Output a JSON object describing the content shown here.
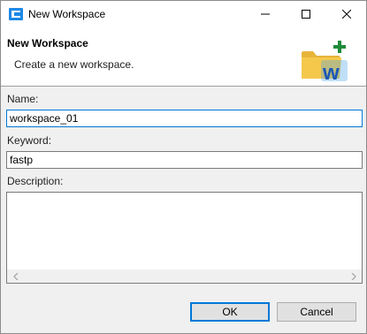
{
  "window": {
    "title": "New Workspace"
  },
  "banner": {
    "title": "New Workspace",
    "description": "Create a new workspace."
  },
  "form": {
    "name_label": "Name:",
    "name_value": "workspace_01",
    "keyword_label": "Keyword:",
    "keyword_value": "fastp",
    "description_label": "Description:",
    "description_value": ""
  },
  "buttons": {
    "ok_label": "OK",
    "cancel_label": "Cancel"
  },
  "icons": {
    "app": "app-icon",
    "banner": "new-workspace-folder-icon",
    "minimize": "minimize-icon",
    "maximize": "maximize-icon",
    "close": "close-icon"
  },
  "colors": {
    "focus_accent": "#0078d7",
    "folder": "#f5c84c",
    "plus": "#1e8a3a",
    "w_letter": "#1a56b5"
  }
}
